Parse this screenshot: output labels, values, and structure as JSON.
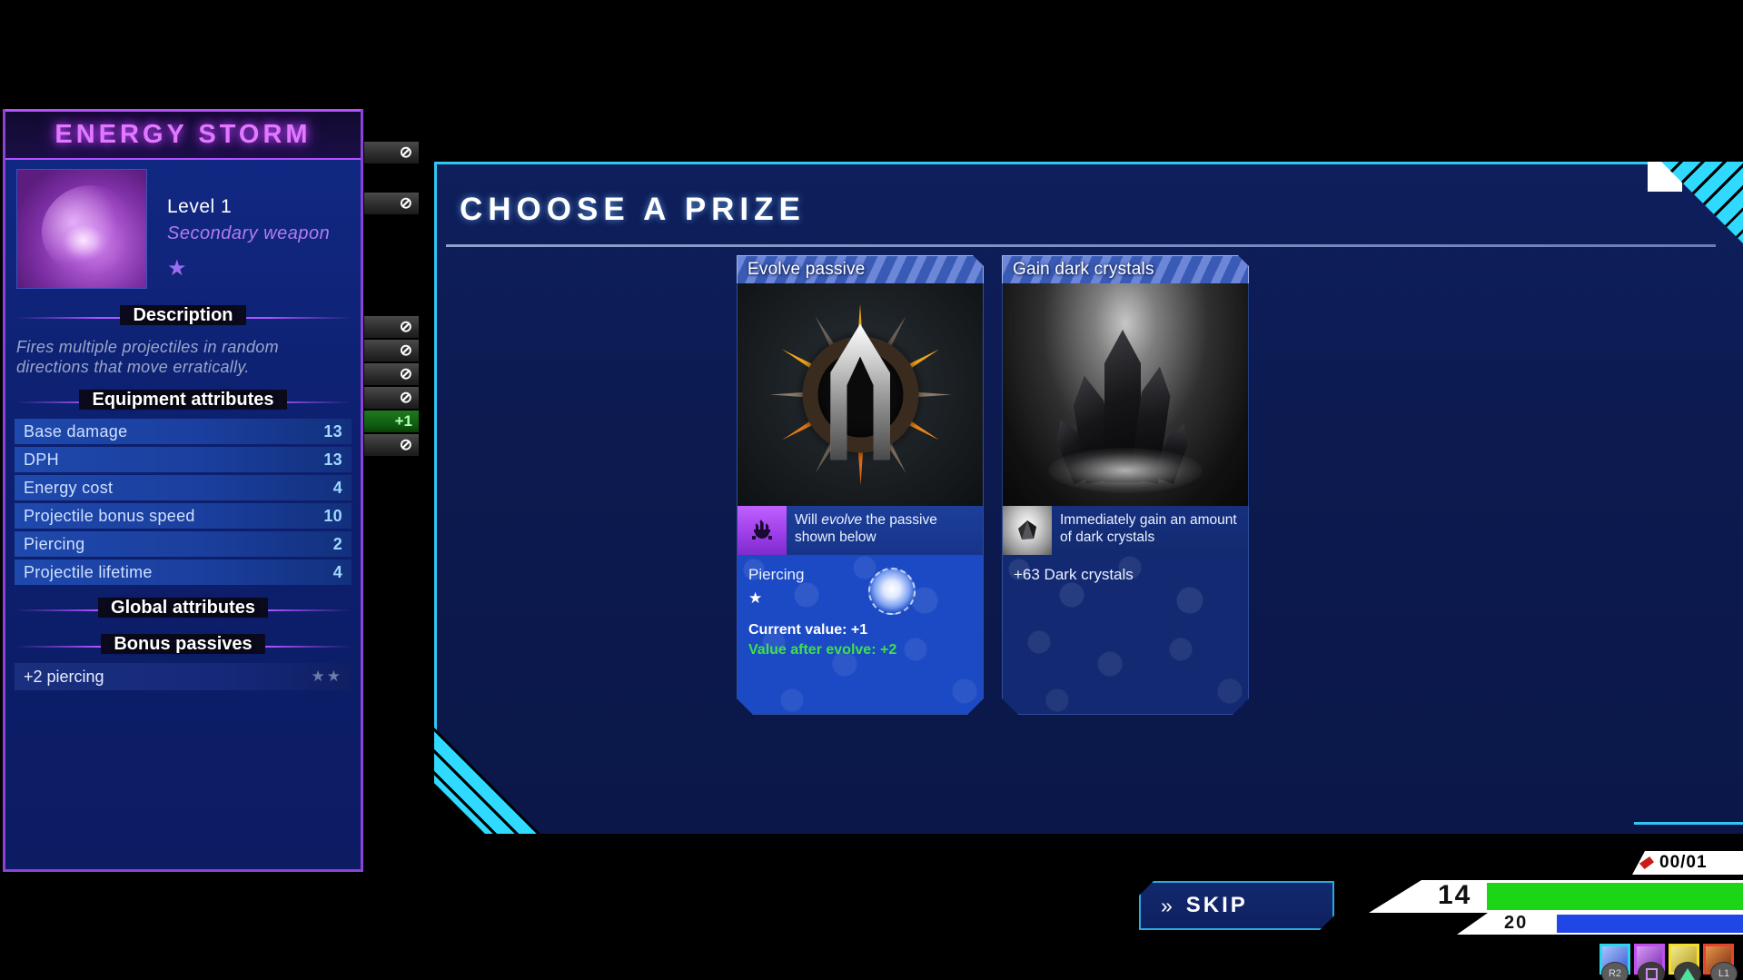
{
  "equipment": {
    "title": "ENERGY STORM",
    "level": "Level 1",
    "type": "Secondary weapon",
    "rarity_stars": "★",
    "description_header": "Description",
    "description": "Fires multiple projectiles in random directions that move erratically.",
    "equipment_attributes_header": "Equipment attributes",
    "attributes": [
      {
        "name": "Base damage",
        "value": "13",
        "delta": "⊘",
        "delta_kind": "none"
      },
      {
        "name": "DPH",
        "value": "13",
        "delta": "⊘",
        "delta_kind": "none"
      },
      {
        "name": "Energy cost",
        "value": "4",
        "delta": "⊘",
        "delta_kind": "none"
      },
      {
        "name": "Projectile bonus speed",
        "value": "10",
        "delta": "⊘",
        "delta_kind": "none"
      },
      {
        "name": "Piercing",
        "value": "2",
        "delta": "+1",
        "delta_kind": "plus"
      },
      {
        "name": "Projectile lifetime",
        "value": "4",
        "delta": "⊘",
        "delta_kind": "none"
      }
    ],
    "global_attributes_header": "Global attributes",
    "bonus_passives_header": "Bonus passives",
    "bonus_passives": [
      {
        "name": "+2 piercing",
        "stars": "★★"
      }
    ]
  },
  "dialog": {
    "title": "CHOOSE  A  PRIZE",
    "close_icon": "close-button"
  },
  "cards": [
    {
      "title": "Evolve passive",
      "art": "evolve-emblem-image",
      "note_icon": "evolve-passive-icon",
      "note_text_1": "Will ",
      "note_text_em": "evolve",
      "note_text_2": " the passive shown below",
      "passive_name": "Piercing",
      "passive_star": "★",
      "current_label": "Current value",
      "current_value": "+1",
      "after_label": "Value after evolve",
      "after_value": "+2"
    },
    {
      "title": "Gain dark crystals",
      "art": "dark-crystal-image",
      "note_icon": "dark-crystal-icon",
      "note_text": "Immediately gain an amount of dark crystals",
      "amount": "+63 Dark crystals"
    }
  ],
  "skip": {
    "label": "SKIP",
    "chevron": "»"
  },
  "hud": {
    "ammo": "00/01",
    "level": "14",
    "sub_level": "20",
    "slots": [
      "weapon-slot-1",
      "weapon-slot-2",
      "weapon-slot-3",
      "weapon-slot-4"
    ],
    "pads": [
      "R2",
      "square",
      "triangle",
      "L1"
    ]
  },
  "colors": {
    "accent_cyan": "#2fc8f5",
    "accent_purple": "#b253ff",
    "positive_green": "#3fe04a",
    "card_selected": "#1c4ac4"
  }
}
